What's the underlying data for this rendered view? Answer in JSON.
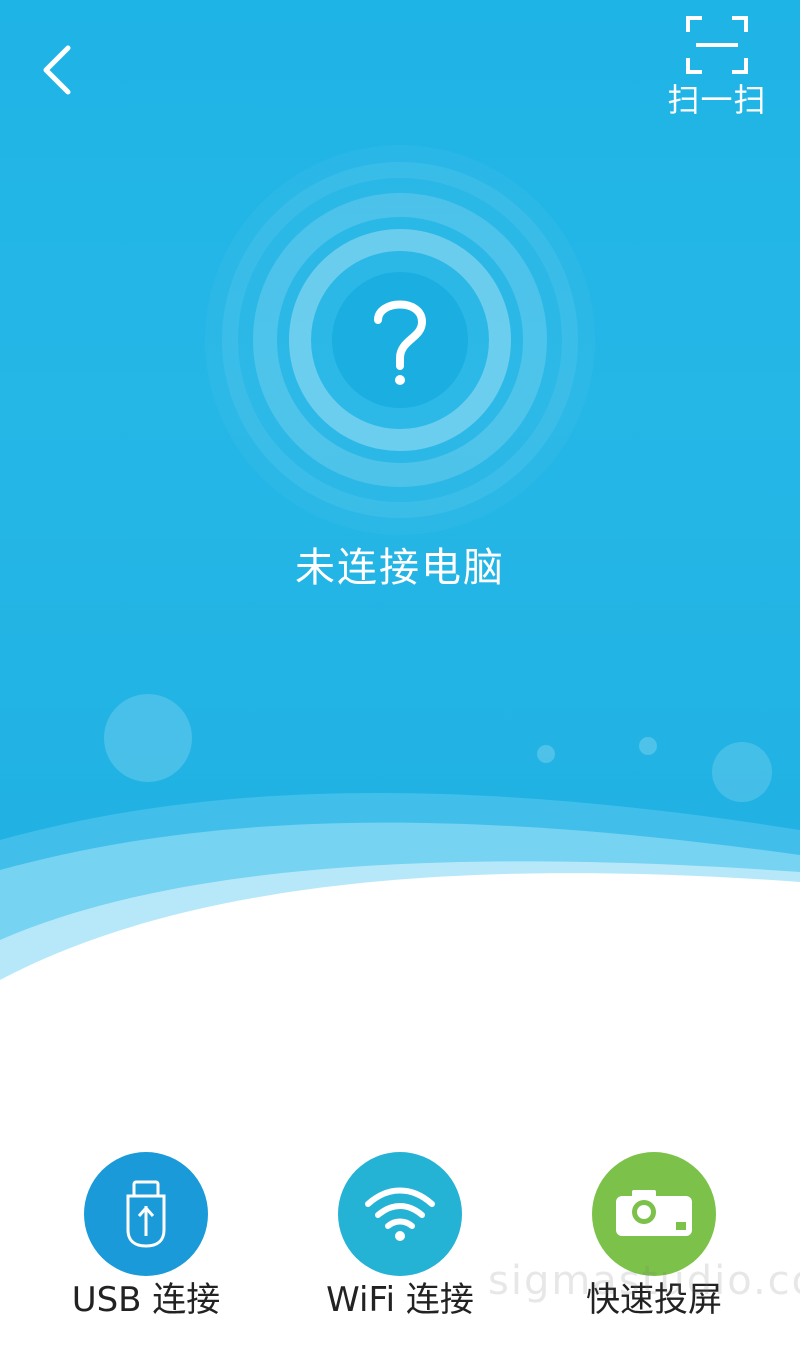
{
  "header": {
    "back_icon": "chevron-left-icon",
    "scan_icon": "scan-frame-icon",
    "scan_label": "扫一扫"
  },
  "status": {
    "icon": "question-mark-icon",
    "text": "未连接电脑"
  },
  "actions": [
    {
      "label": "USB 连接",
      "icon": "usb-drive-icon",
      "color": "#1a9ad8"
    },
    {
      "label": "WiFi 连接",
      "icon": "wifi-icon",
      "color": "#25b3d5"
    },
    {
      "label": "快速投屏",
      "icon": "projector-icon",
      "color": "#7cc24a"
    }
  ],
  "watermark": "sigmastudio.com",
  "colors": {
    "hero_top": "#1fb4e6",
    "hero_bottom": "#1fb0e2",
    "white": "#ffffff"
  }
}
